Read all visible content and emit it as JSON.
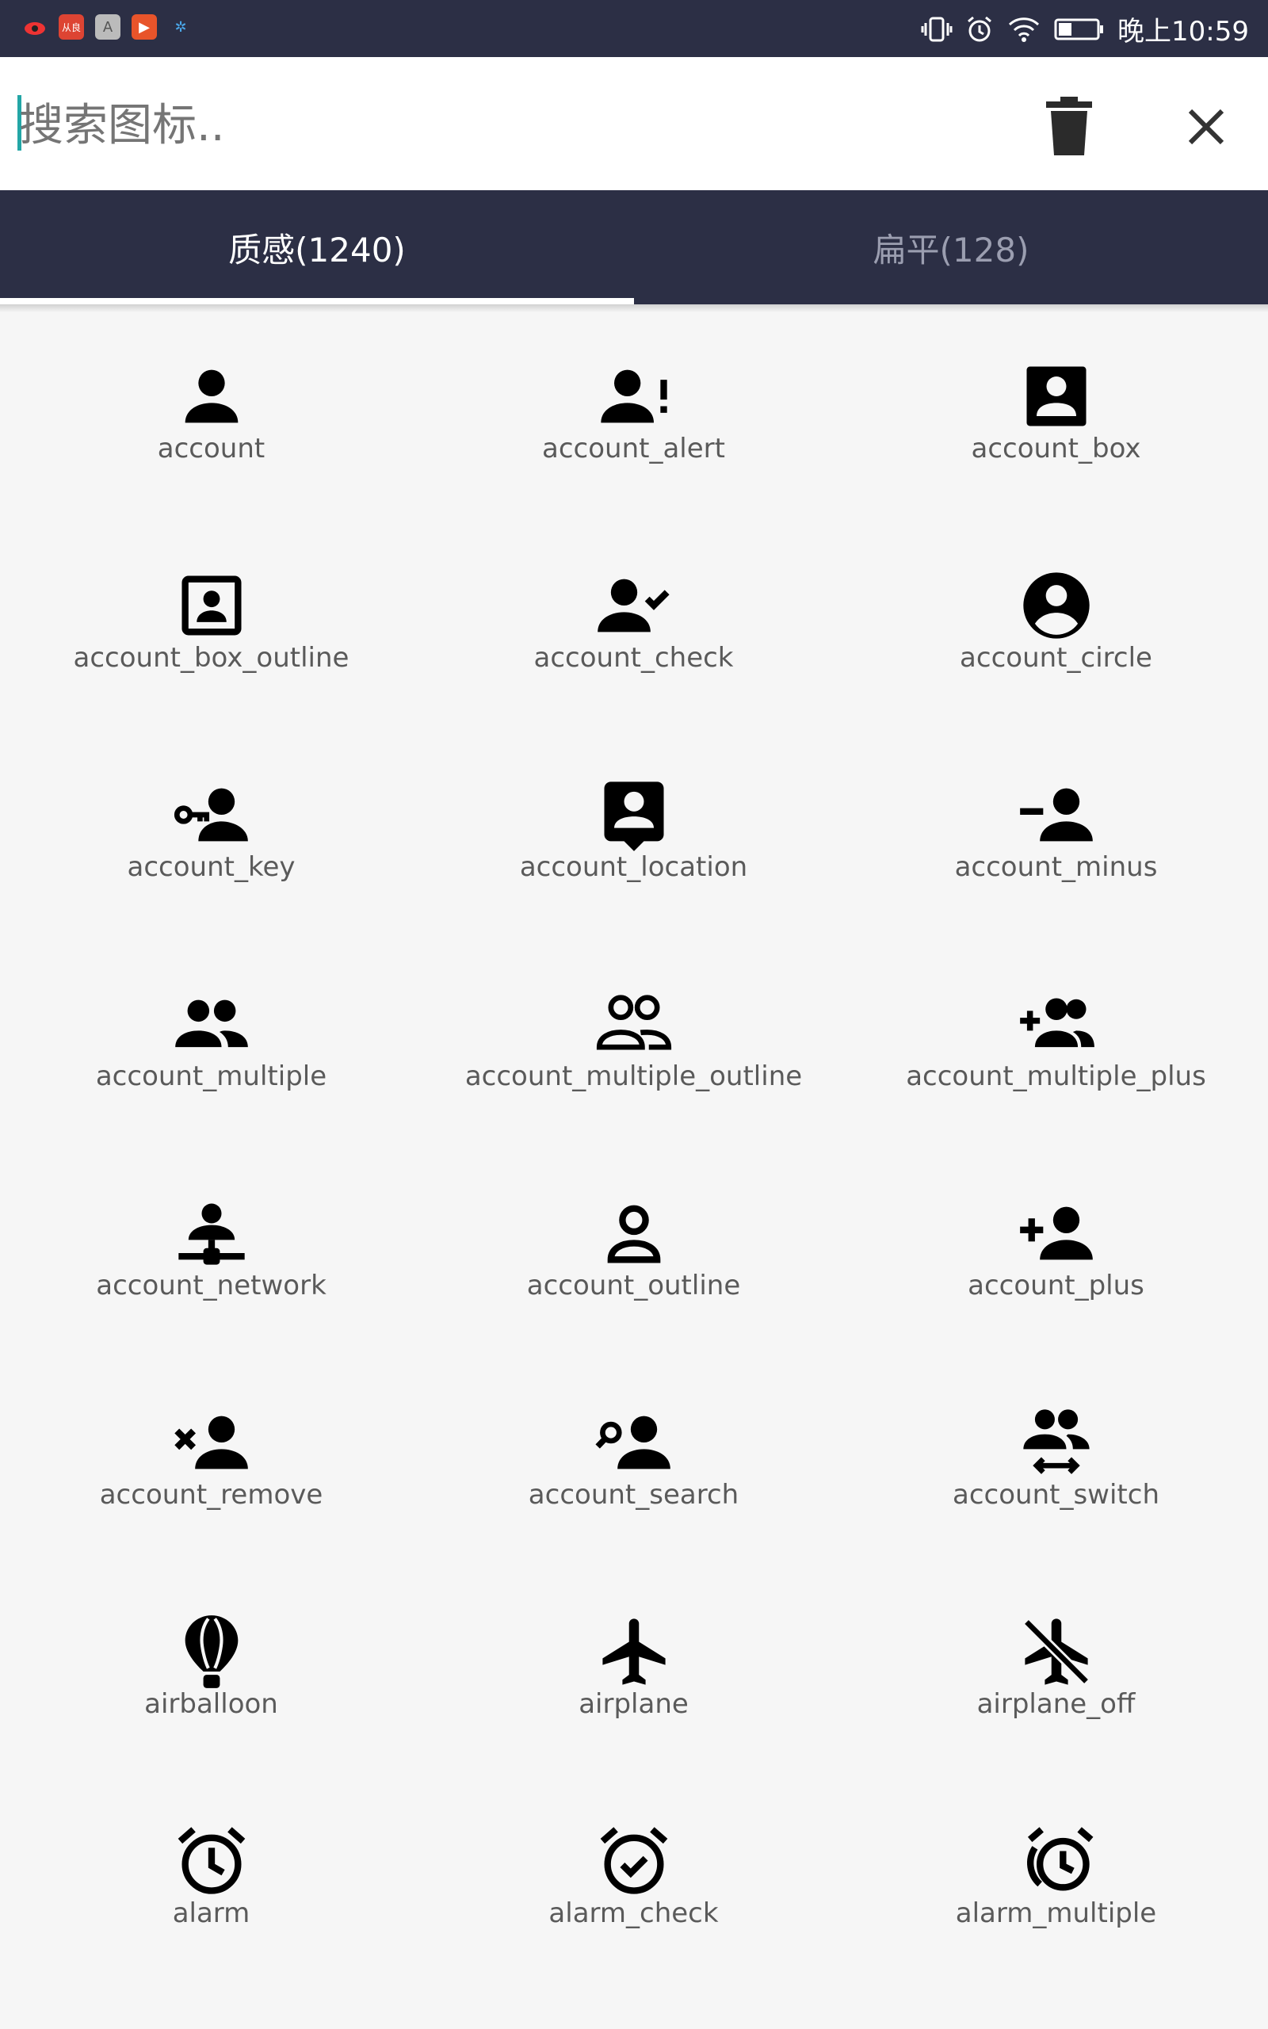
{
  "status_bar": {
    "time": "晚上10:59",
    "app_icons": [
      "eye-app-icon",
      "tag-app-icon",
      "a-app-icon",
      "play-app-icon",
      "gear-app-icon"
    ],
    "app_labels": [
      "",
      "从良",
      "A",
      "▶",
      "✲"
    ],
    "indicators": [
      "vibrate-icon",
      "alarm-status-icon",
      "wifi-icon",
      "battery-icon"
    ]
  },
  "search": {
    "placeholder": "搜索图标.."
  },
  "tabs": [
    {
      "label": "质感(1240)",
      "active": true
    },
    {
      "label": "扁平(128)",
      "active": false
    }
  ],
  "colors": {
    "bar": "#2c2f45",
    "accent_cursor": "#23a6a6",
    "icon": "#000000",
    "label": "#5a5a5a"
  },
  "icons": [
    {
      "name": "account"
    },
    {
      "name": "account_alert"
    },
    {
      "name": "account_box"
    },
    {
      "name": "account_box_outline"
    },
    {
      "name": "account_check"
    },
    {
      "name": "account_circle"
    },
    {
      "name": "account_key"
    },
    {
      "name": "account_location"
    },
    {
      "name": "account_minus"
    },
    {
      "name": "account_multiple"
    },
    {
      "name": "account_multiple_outline"
    },
    {
      "name": "account_multiple_plus"
    },
    {
      "name": "account_network"
    },
    {
      "name": "account_outline"
    },
    {
      "name": "account_plus"
    },
    {
      "name": "account_remove"
    },
    {
      "name": "account_search"
    },
    {
      "name": "account_switch"
    },
    {
      "name": "airballoon"
    },
    {
      "name": "airplane"
    },
    {
      "name": "airplane_off"
    },
    {
      "name": "alarm"
    },
    {
      "name": "alarm_check"
    },
    {
      "name": "alarm_multiple"
    }
  ]
}
